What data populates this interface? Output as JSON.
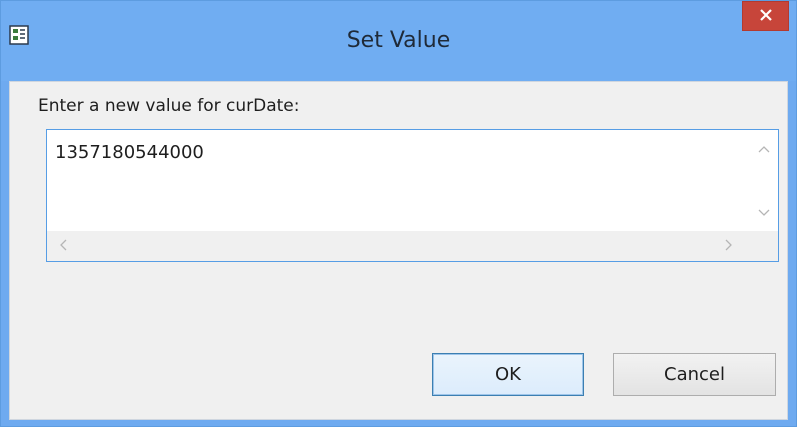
{
  "window": {
    "title": "Set Value"
  },
  "dialog": {
    "prompt": "Enter a new value for curDate:",
    "value": "1357180544000"
  },
  "buttons": {
    "ok_label": "OK",
    "cancel_label": "Cancel"
  },
  "icons": {
    "app": "app-icon",
    "close": "close-icon",
    "scroll_up": "chevron-up-icon",
    "scroll_down": "chevron-down-icon",
    "scroll_left": "chevron-left-icon",
    "scroll_right": "chevron-right-icon"
  },
  "colors": {
    "titlebar": "#70adf2",
    "close_button": "#c7453a",
    "content_bg": "#f0f0f0",
    "input_border": "#569de5",
    "ok_border": "#3c7fb1"
  }
}
